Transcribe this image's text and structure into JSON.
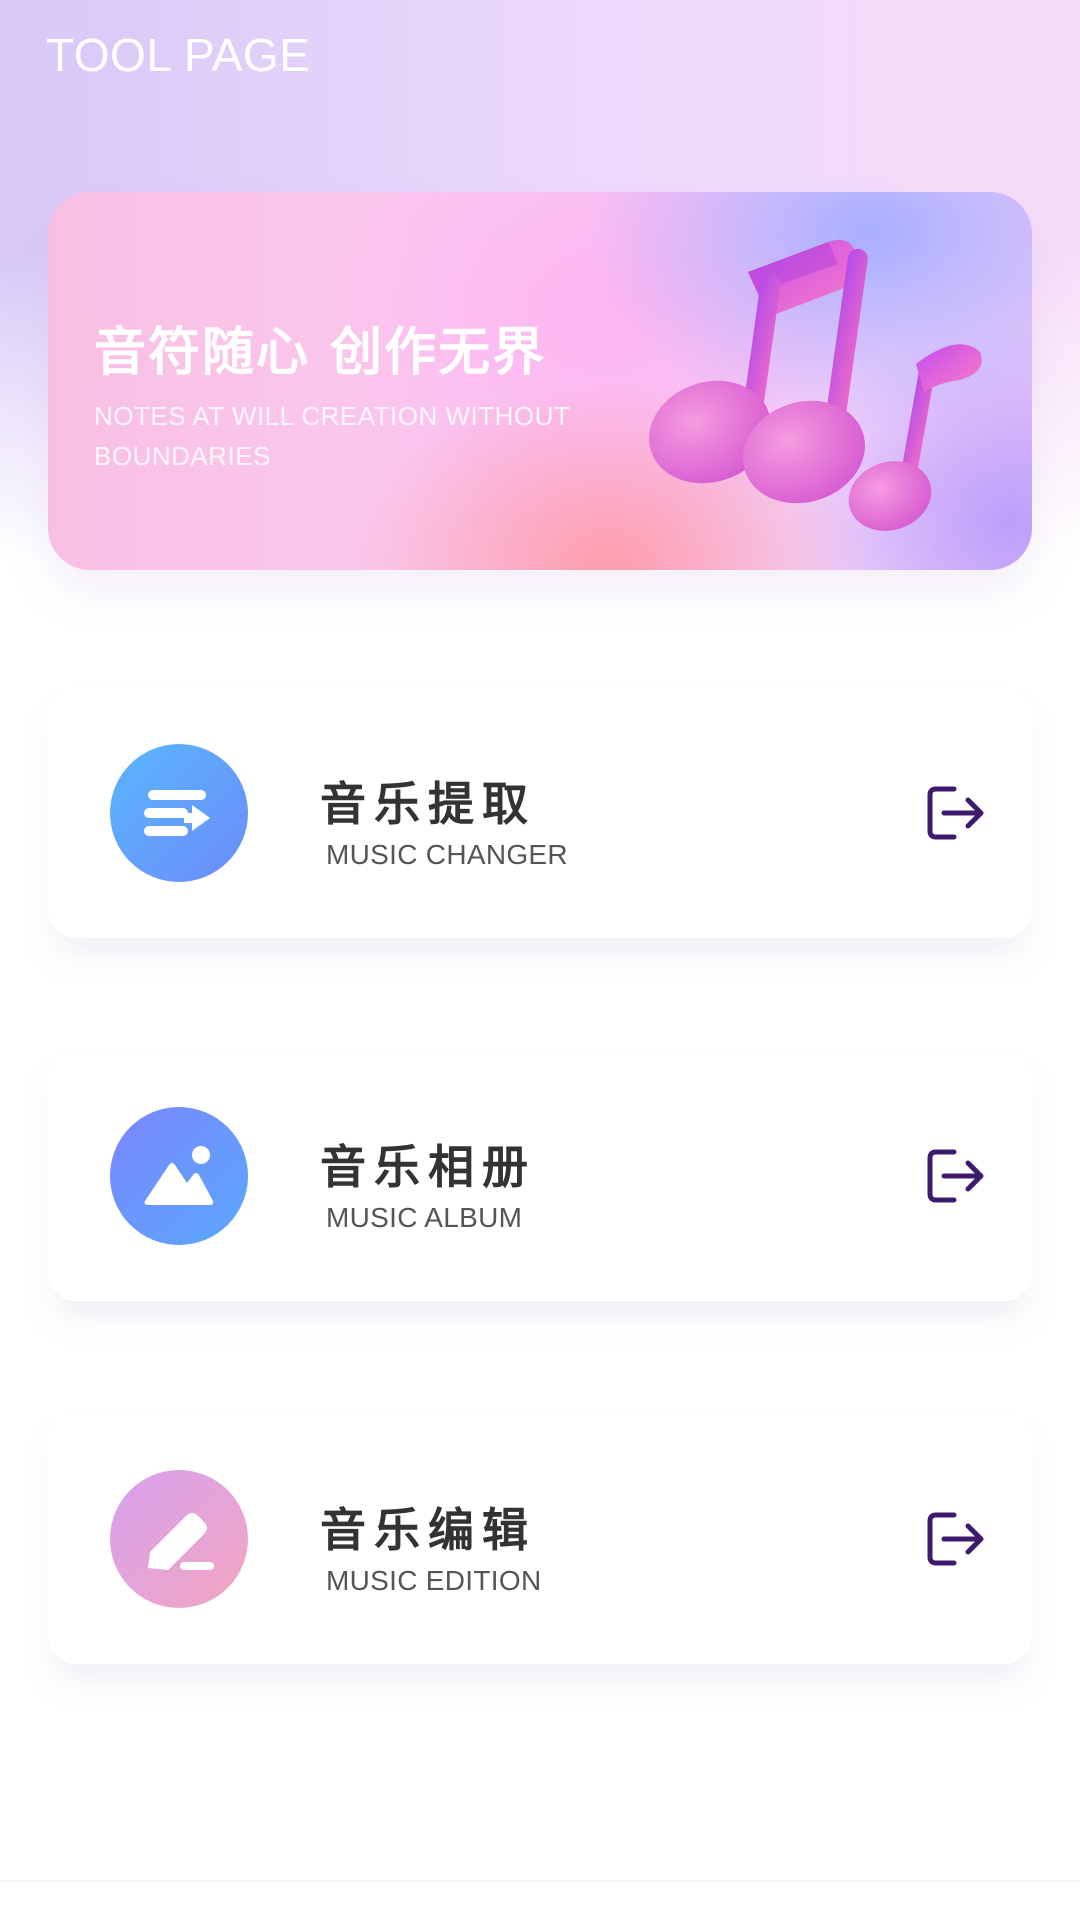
{
  "header": {
    "title": "TOOL PAGE"
  },
  "banner": {
    "title": "音符随心 创作无界",
    "subtitle": "NOTES AT WILL CREATION WITHOUT BOUNDARIES",
    "art_icon": "music-notes-icon"
  },
  "tools": [
    {
      "title": "音乐提取",
      "subtitle": "MUSIC CHANGER",
      "icon": "list-extract-icon",
      "action_icon": "exit-arrow-icon"
    },
    {
      "title": "音乐相册",
      "subtitle": "MUSIC ALBUM",
      "icon": "picture-icon",
      "action_icon": "exit-arrow-icon"
    },
    {
      "title": "音乐编辑",
      "subtitle": "MUSIC EDITION",
      "icon": "pencil-icon",
      "action_icon": "exit-arrow-icon"
    }
  ],
  "colors": {
    "action_icon": "#3d1a6b",
    "title_text": "#333333",
    "subtitle_text": "#555555"
  }
}
